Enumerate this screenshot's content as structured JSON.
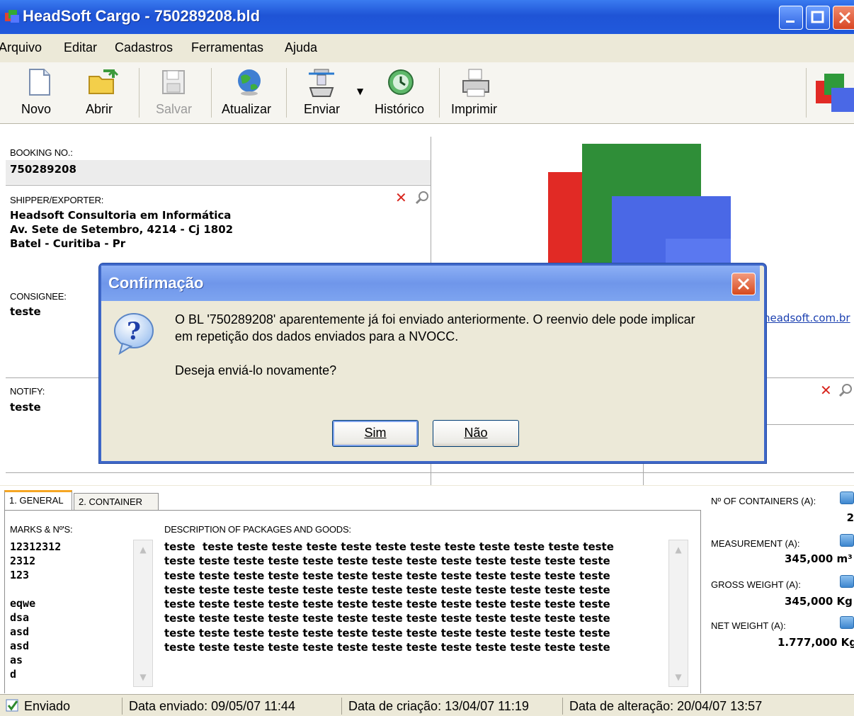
{
  "window": {
    "title": "HeadSoft Cargo - 750289208.bld"
  },
  "menu": [
    "Arquivo",
    "Editar",
    "Cadastros",
    "Ferramentas",
    "Ajuda"
  ],
  "toolbar": {
    "novo": "Novo",
    "abrir": "Abrir",
    "salvar": "Salvar",
    "atualizar": "Atualizar",
    "enviar": "Enviar",
    "historico": "Histórico",
    "imprimir": "Imprimir"
  },
  "form": {
    "booking_label": "BOOKING NO.:",
    "booking_value": "750289208",
    "shipper_label": "SHIPPER/EXPORTER:",
    "shipper_lines": [
      "Headsoft Consultoria em Informática",
      "Av. Sete de Setembro, 4214 - Cj 1802",
      "Batel - Curitiba - Pr"
    ],
    "consignee_label": "CONSIGNEE:",
    "consignee_value": "teste",
    "notify_label": "NOTIFY:",
    "notify_value": "teste",
    "website": "headsoft.com.br"
  },
  "tabs": {
    "general": "1. GENERAL",
    "container": "2. CONTAINER"
  },
  "goods": {
    "marks_label": "MARKS & Nº'S:",
    "marks_lines": [
      "12312312",
      "2312",
      "123",
      "",
      "eqwe",
      "dsa",
      "asd",
      "asd",
      "as",
      "d"
    ],
    "desc_label": "DESCRIPTION OF PACKAGES AND GOODS:",
    "desc_lines": [
      "teste  teste teste teste teste teste teste teste teste teste teste teste teste",
      "teste teste teste teste teste teste teste teste teste teste teste teste teste",
      "teste teste teste teste teste teste teste teste teste teste teste teste teste",
      "teste teste teste teste teste teste teste teste teste teste teste teste teste",
      "teste teste teste teste teste teste teste teste teste teste teste teste teste",
      "teste teste teste teste teste teste teste teste teste teste teste teste teste",
      "teste teste teste teste teste teste teste teste teste teste teste teste teste",
      "teste teste teste teste teste teste teste teste teste teste teste teste teste"
    ]
  },
  "summary": {
    "containers_label": "Nº OF CONTAINERS (A):",
    "containers_value": "2",
    "measurement_label": "MEASUREMENT (A):",
    "measurement_value": "345,000 m³",
    "gross_label": "GROSS WEIGHT (A):",
    "gross_value": "345,000 Kg",
    "net_label": "NET WEIGHT (A):",
    "net_value": "1.777,000 Kg"
  },
  "status": {
    "state": "Enviado",
    "sent": "Data enviado: 09/05/07 11:44",
    "created": "Data de criação: 13/04/07 11:19",
    "changed": "Data de alteração: 20/04/07 13:57"
  },
  "dialog": {
    "title": "Confirmação",
    "line1": "O BL '750289208' aparentemente já foi enviado anteriormente. O reenvio dele pode implicar",
    "line2": "em repetição dos dados enviados para a NVOCC.",
    "line3": "Deseja enviá-lo novamente?",
    "yes": "Sim",
    "no": "Não"
  },
  "colors": {
    "titlebar": "#2059dc",
    "dialog_title": "#7da4f0",
    "logo_red": "#e02020",
    "logo_green": "#2f9a3a",
    "logo_blue": "#3b63e0"
  }
}
